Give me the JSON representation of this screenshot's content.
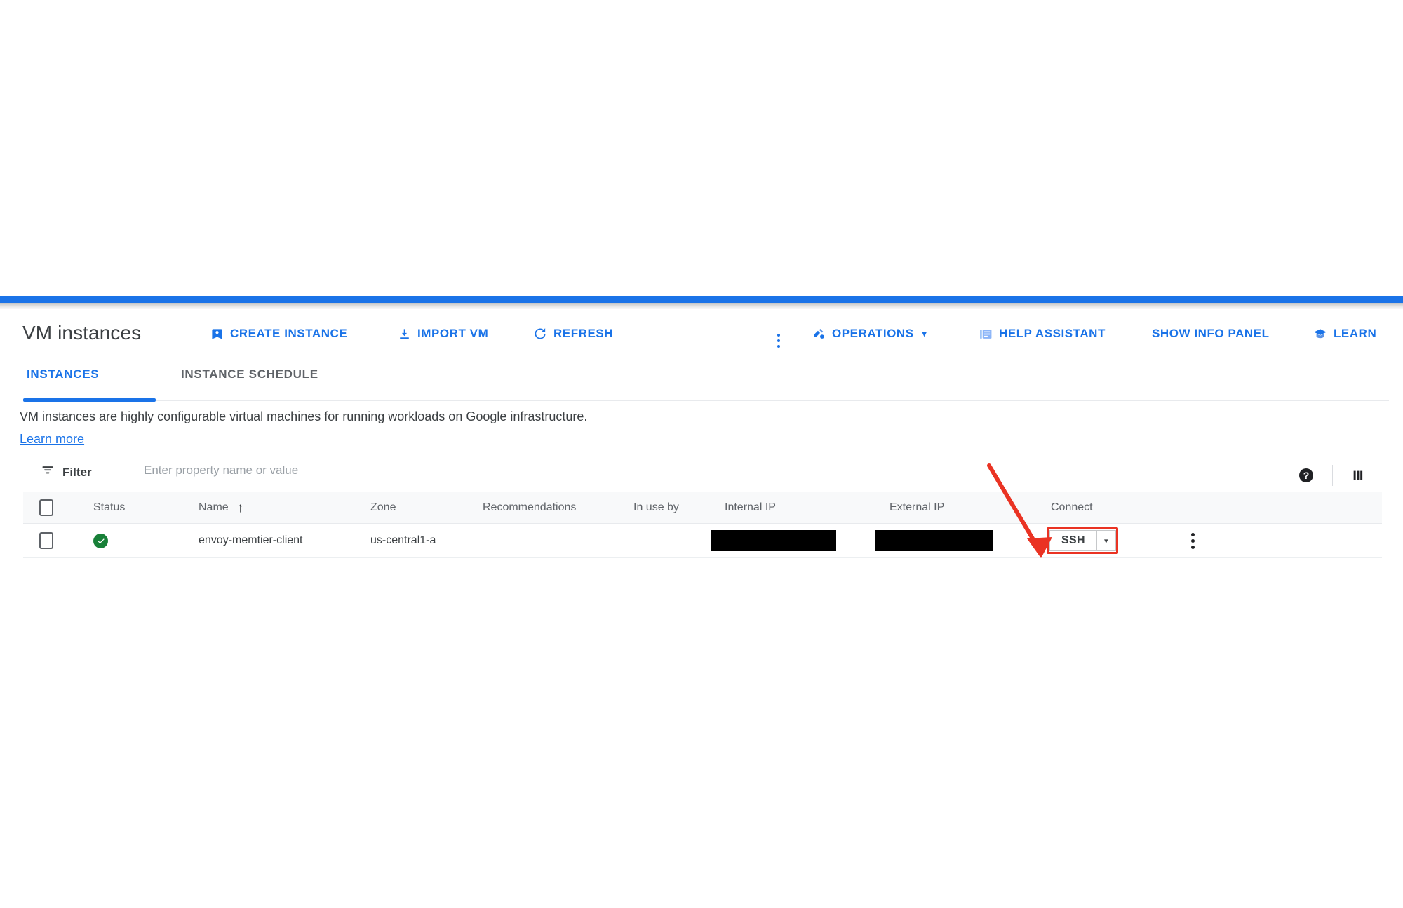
{
  "page": {
    "title": "VM instances",
    "accent_color": "#1a73e8"
  },
  "toolbar": {
    "buttons": [
      {
        "label": "CREATE INSTANCE",
        "icon": "bookmark-instance-icon"
      },
      {
        "label": "IMPORT VM",
        "icon": "download-icon"
      },
      {
        "label": "REFRESH",
        "icon": "refresh-icon"
      },
      {
        "label": "OPERATIONS",
        "icon": "operations-icon",
        "caret": "▾"
      },
      {
        "label": "HELP ASSISTANT",
        "icon": "help-assistant-icon"
      },
      {
        "label": "SHOW INFO PANEL",
        "icon": null
      },
      {
        "label": "LEARN",
        "icon": "learn-graduation-icon"
      }
    ],
    "overflow_menu": "more-options-icon"
  },
  "tabs": [
    {
      "label": "INSTANCES",
      "active": true
    },
    {
      "label": "INSTANCE SCHEDULE",
      "active": false
    }
  ],
  "description": {
    "text": "VM instances are highly configurable virtual machines for running workloads on Google infrastructure.",
    "link": "Learn more"
  },
  "filter": {
    "label": "Filter",
    "placeholder": "Enter property name or value",
    "value": "",
    "help_icon": "help-circle-icon",
    "columns_icon": "column-display-icon"
  },
  "table": {
    "columns": [
      "Status",
      "Name",
      "Zone",
      "Recommendations",
      "In use by",
      "Internal IP",
      "External IP",
      "Connect"
    ],
    "sorted_column": "Name",
    "sort_direction": "↑",
    "rows": [
      {
        "selected": false,
        "status": "running",
        "name": "envoy-memtier-client",
        "zone": "us-central1-a",
        "recommendations": "",
        "in_use_by": "",
        "internal_ip": "[redacted]",
        "external_ip": "[redacted]",
        "connect_label": "SSH",
        "connect_caret": "▾",
        "row_menu": "row-more-options-icon"
      }
    ]
  },
  "annotation": {
    "arrow_color": "#ea3323",
    "highlight_color": "#ea3323",
    "target": "SSH"
  }
}
